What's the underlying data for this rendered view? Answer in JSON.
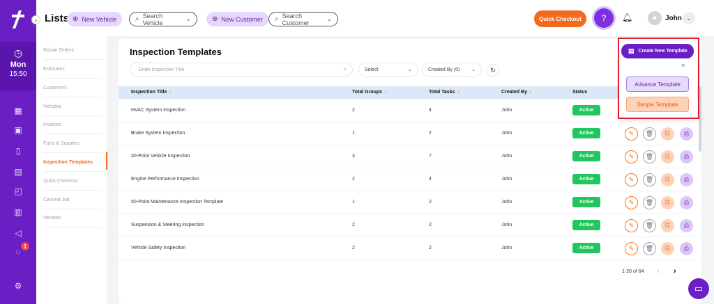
{
  "header": {
    "title": "Lists",
    "new_vehicle": "New Vehicle",
    "search_vehicle": "Search Vehicle",
    "new_customer": "New Customer",
    "search_customer": "Search Customer",
    "quick_checkout": "Quick Checkout",
    "user_name": "John"
  },
  "rail": {
    "day": "Mon",
    "time": "15:50",
    "notification_count": "1"
  },
  "sidebar": {
    "items": [
      {
        "label": "Repair Orders"
      },
      {
        "label": "Estimates"
      },
      {
        "label": "Customers"
      },
      {
        "label": "Vehicles"
      },
      {
        "label": "Invoices"
      },
      {
        "label": "Parts & Supplies"
      },
      {
        "label": "Inspection Templates"
      },
      {
        "label": "Quick Checkout"
      },
      {
        "label": "Canned Job"
      },
      {
        "label": "Vendors"
      }
    ],
    "active": "Inspection Templates"
  },
  "main": {
    "title": "Inspection Templates",
    "search_placeholder": "Enter Inspection Title",
    "select_label": "Select",
    "created_by_filter": "Created By (0)",
    "create_button": "Create New Template",
    "dropdown": {
      "advance": "Advance Template",
      "simple": "Simple Template"
    },
    "columns": [
      "Inspection Title",
      "Total Groups",
      "Total Tasks",
      "Created By",
      "Status"
    ],
    "rows": [
      {
        "title": "HVAC System Inspection",
        "groups": "2",
        "tasks": "4",
        "created_by": "John",
        "status": "Active"
      },
      {
        "title": "Brake System Inspection",
        "groups": "1",
        "tasks": "2",
        "created_by": "John",
        "status": "Active"
      },
      {
        "title": "30-Point Vehicle Inspection",
        "groups": "3",
        "tasks": "7",
        "created_by": "John",
        "status": "Active"
      },
      {
        "title": "Engine Performance Inspection",
        "groups": "2",
        "tasks": "4",
        "created_by": "John",
        "status": "Active"
      },
      {
        "title": "50-Point Maintenance Inspection Template",
        "groups": "1",
        "tasks": "2",
        "created_by": "John",
        "status": "Active"
      },
      {
        "title": "Suspension & Steering Inspection",
        "groups": "2",
        "tasks": "2",
        "created_by": "John",
        "status": "Active"
      },
      {
        "title": "Vehicle Safety Inspection",
        "groups": "2",
        "tasks": "2",
        "created_by": "John",
        "status": "Active"
      }
    ],
    "pagination": "1-20 of 64"
  },
  "icons": {
    "edit": "pencil-icon",
    "delete": "trash-icon",
    "copy": "copy-icon",
    "print": "printer-icon"
  },
  "colors": {
    "brand": "#6a1fc4",
    "accent": "#f26a1b",
    "status_active": "#22c55e",
    "highlight_box": "#e11d2f"
  }
}
